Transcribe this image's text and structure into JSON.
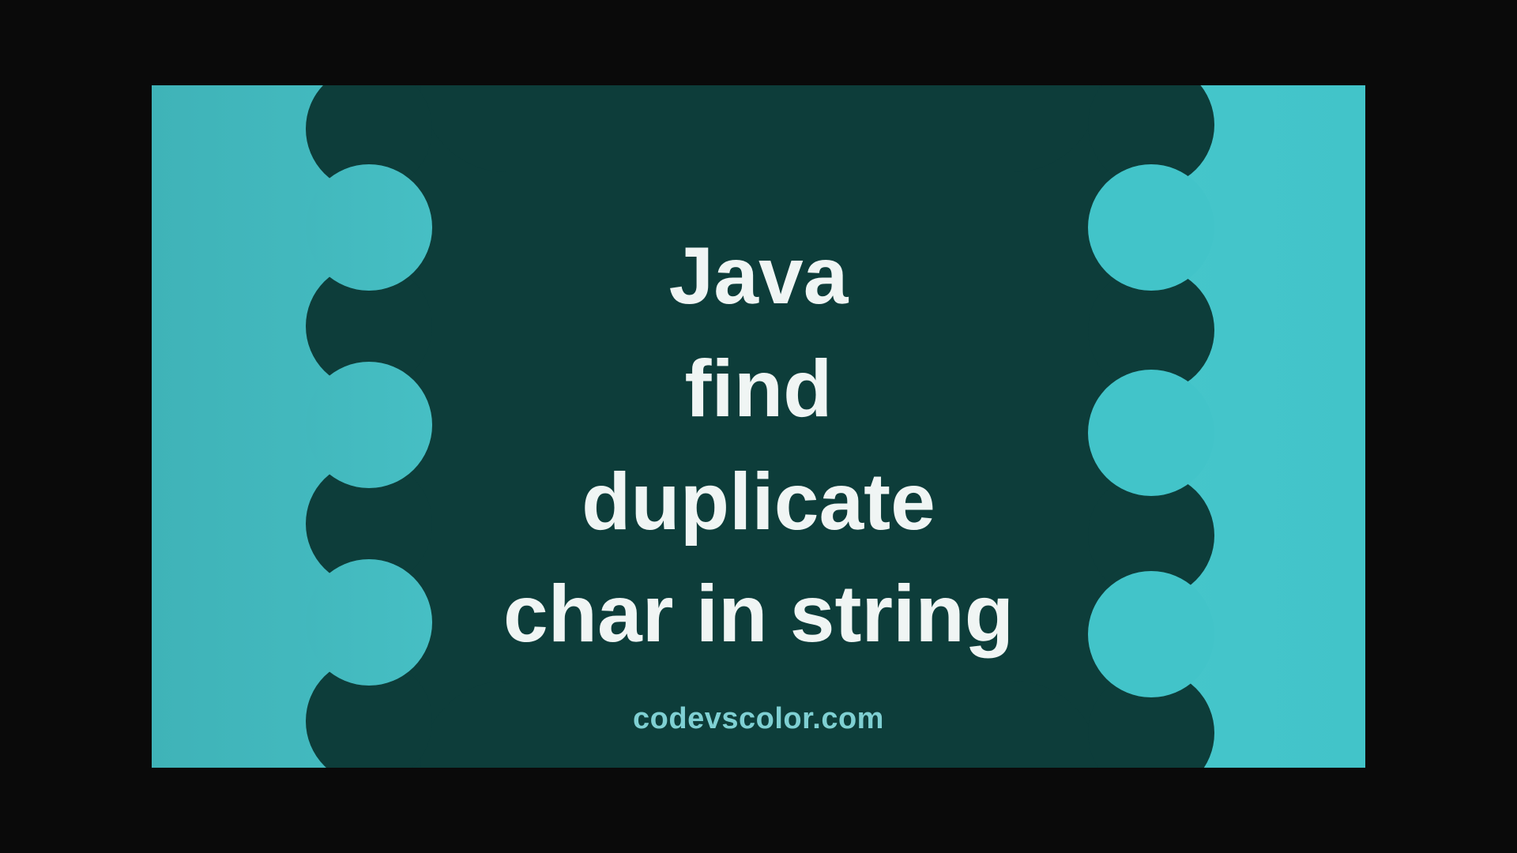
{
  "title": {
    "line1": "Java",
    "line2": "find",
    "line3": "duplicate",
    "line4": "char in string"
  },
  "footer": "codevscolor.com",
  "colors": {
    "background_teal": "#42c4c9",
    "blob_dark": "#0d3d3a",
    "text_light": "#f0f5f4",
    "footer_text": "#7fd0d3"
  }
}
